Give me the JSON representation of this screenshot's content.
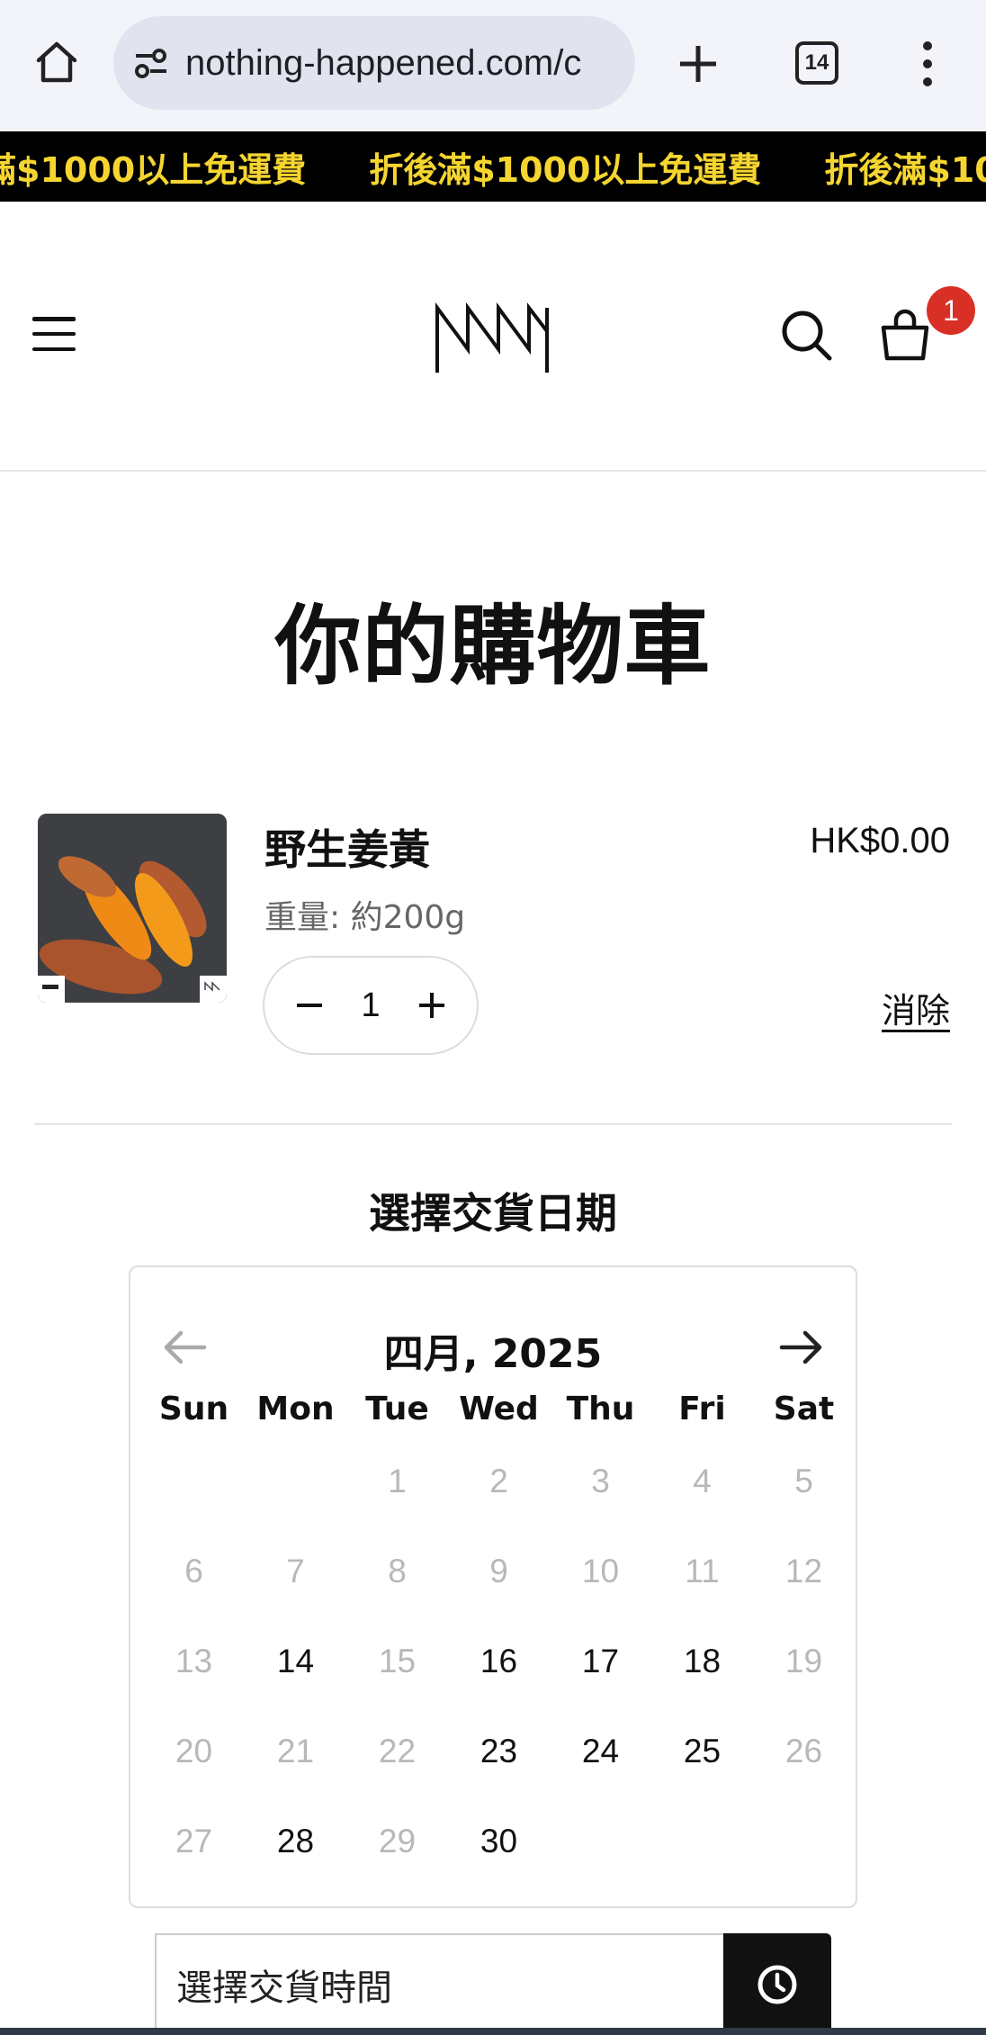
{
  "browser": {
    "url": "nothing-happened.com/c",
    "tab_count": "14"
  },
  "announcement": {
    "messages": [
      "折後滿$1000以上免運費",
      "折後滿$1000以上免運費",
      "折後滿$1000以上免運費"
    ]
  },
  "header": {
    "cart_count": "1"
  },
  "page": {
    "title": "你的購物車"
  },
  "cart_item": {
    "name": "野生姜黃",
    "variant": "重量: 約200g",
    "price": "HK$0.00",
    "quantity": "1",
    "remove_label": "消除"
  },
  "delivery": {
    "title": "選擇交貨日期",
    "month_label": "四月, 2025",
    "weekdays": [
      "Sun",
      "Mon",
      "Tue",
      "Wed",
      "Thu",
      "Fri",
      "Sat"
    ],
    "days": [
      "",
      "",
      "1",
      "2",
      "3",
      "4",
      "5",
      "6",
      "7",
      "8",
      "9",
      "10",
      "11",
      "12",
      "13",
      "14",
      "15",
      "16",
      "17",
      "18",
      "19",
      "20",
      "21",
      "22",
      "23",
      "24",
      "25",
      "26",
      "27",
      "28",
      "29",
      "30",
      "",
      "",
      ""
    ],
    "available_days": [
      "14",
      "16",
      "17",
      "18",
      "23",
      "24",
      "25",
      "28",
      "30"
    ],
    "time_placeholder": "選擇交貨時間"
  },
  "colors": {
    "announcement_bg": "#000000",
    "announcement_text": "#f5d530",
    "badge": "#d93025",
    "disabled_day": "#b8b8b8"
  }
}
